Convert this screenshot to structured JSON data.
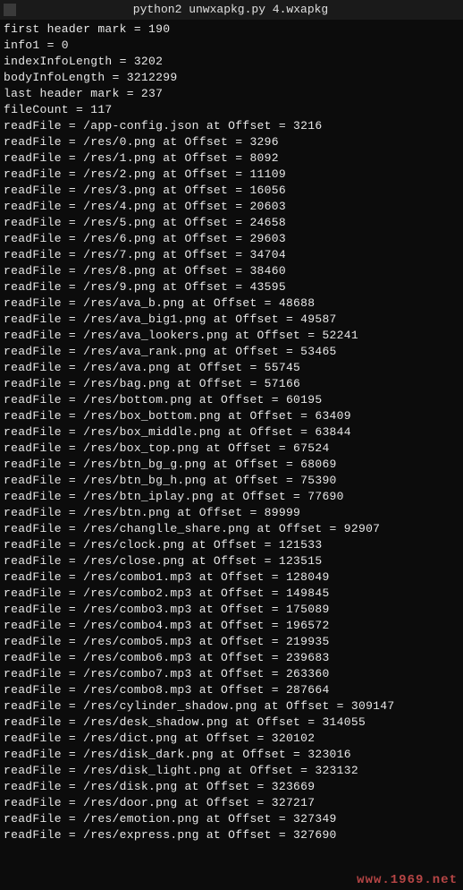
{
  "title_command": "python2 unwxapkg.py 4.wxapkg",
  "header_lines": [
    "first header mark = 190",
    "info1 = 0",
    "indexInfoLength = 3202",
    "bodyInfoLength = 3212299",
    "last header mark = 237",
    "fileCount = 117"
  ],
  "file_entries": [
    {
      "path": "/app-config.json",
      "offset": 3216
    },
    {
      "path": "/res/0.png",
      "offset": 3296
    },
    {
      "path": "/res/1.png",
      "offset": 8092
    },
    {
      "path": "/res/2.png",
      "offset": 11109
    },
    {
      "path": "/res/3.png",
      "offset": 16056
    },
    {
      "path": "/res/4.png",
      "offset": 20603
    },
    {
      "path": "/res/5.png",
      "offset": 24658
    },
    {
      "path": "/res/6.png",
      "offset": 29603
    },
    {
      "path": "/res/7.png",
      "offset": 34704
    },
    {
      "path": "/res/8.png",
      "offset": 38460
    },
    {
      "path": "/res/9.png",
      "offset": 43595
    },
    {
      "path": "/res/ava_b.png",
      "offset": 48688
    },
    {
      "path": "/res/ava_big1.png",
      "offset": 49587
    },
    {
      "path": "/res/ava_lookers.png",
      "offset": 52241
    },
    {
      "path": "/res/ava_rank.png",
      "offset": 53465
    },
    {
      "path": "/res/ava.png",
      "offset": 55745
    },
    {
      "path": "/res/bag.png",
      "offset": 57166
    },
    {
      "path": "/res/bottom.png",
      "offset": 60195
    },
    {
      "path": "/res/box_bottom.png",
      "offset": 63409
    },
    {
      "path": "/res/box_middle.png",
      "offset": 63844
    },
    {
      "path": "/res/box_top.png",
      "offset": 67524
    },
    {
      "path": "/res/btn_bg_g.png",
      "offset": 68069
    },
    {
      "path": "/res/btn_bg_h.png",
      "offset": 75390
    },
    {
      "path": "/res/btn_iplay.png",
      "offset": 77690
    },
    {
      "path": "/res/btn.png",
      "offset": 89999
    },
    {
      "path": "/res/changlle_share.png",
      "offset": 92907
    },
    {
      "path": "/res/clock.png",
      "offset": 121533
    },
    {
      "path": "/res/close.png",
      "offset": 123515
    },
    {
      "path": "/res/combo1.mp3",
      "offset": 128049
    },
    {
      "path": "/res/combo2.mp3",
      "offset": 149845
    },
    {
      "path": "/res/combo3.mp3",
      "offset": 175089
    },
    {
      "path": "/res/combo4.mp3",
      "offset": 196572
    },
    {
      "path": "/res/combo5.mp3",
      "offset": 219935
    },
    {
      "path": "/res/combo6.mp3",
      "offset": 239683
    },
    {
      "path": "/res/combo7.mp3",
      "offset": 263360
    },
    {
      "path": "/res/combo8.mp3",
      "offset": 287664
    },
    {
      "path": "/res/cylinder_shadow.png",
      "offset": 309147
    },
    {
      "path": "/res/desk_shadow.png",
      "offset": 314055
    },
    {
      "path": "/res/dict.png",
      "offset": 320102
    },
    {
      "path": "/res/disk_dark.png",
      "offset": 323016
    },
    {
      "path": "/res/disk_light.png",
      "offset": 323132
    },
    {
      "path": "/res/disk.png",
      "offset": 323669
    },
    {
      "path": "/res/door.png",
      "offset": 327217
    },
    {
      "path": "/res/emotion.png",
      "offset": 327349
    },
    {
      "path": "/res/express.png",
      "offset": 327690
    }
  ],
  "read_prefix": "readFile = ",
  "offset_label": " at Offset = ",
  "watermark": "www.1969.net"
}
